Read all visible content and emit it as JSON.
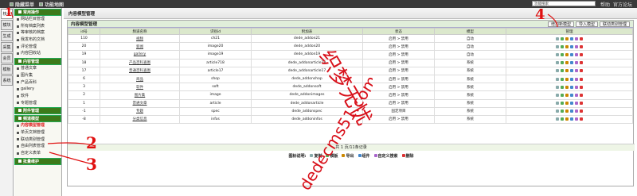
{
  "topbar": {
    "hide_menu": "隐藏菜单",
    "func_map": "功能地图",
    "right": [
      "帮助",
      "官方论坛"
    ]
  },
  "search": "功能搜索",
  "vtabs": [
    "核心",
    "模块",
    "生成",
    "采集",
    "会员",
    "模板",
    "系统"
  ],
  "sidebar": {
    "groups": [
      {
        "title": "常用操作",
        "items": [
          "网站栏目管理",
          "所有档案列表",
          "等审核的档案",
          "我发布的文档",
          "评论管理",
          "内容回收站"
        ]
      },
      {
        "title": "内容管理",
        "items": [
          "普通文章",
          "图片集",
          "产品百科",
          "gallery",
          "软件",
          "专题管理"
        ]
      },
      {
        "title": "附件管理",
        "items": []
      },
      {
        "title": "频道模型",
        "items": [
          "内容模型管理",
          "单页文档管理",
          "联动类别管理",
          "自由列表管理",
          "自定义表单"
        ]
      },
      {
        "title": "批量维护",
        "items": []
      }
    ]
  },
  "main": {
    "header": "内容模型管理",
    "bar_title": "内容模型管理",
    "buttons": [
      "增加新模型",
      "导入模型",
      "联动类别管理"
    ]
  },
  "table": {
    "headers": [
      "id号",
      "频道名称",
      "识别id",
      "附加表",
      "状态",
      "模型",
      "管理"
    ],
    "rows": [
      [
        "110",
        "视频",
        "ch21",
        "dede_addon21",
        "启用 > 禁用",
        "自动"
      ],
      [
        "20",
        "新闻",
        "image20",
        "dede_addon20",
        "启用 > 禁用",
        "自动"
      ],
      [
        "19",
        "gallery",
        "image19",
        "dede_addon19",
        "启用 > 禁用",
        "自动"
      ],
      [
        "18",
        "产品百科查图",
        "article718",
        "dede_addonarticle18",
        "启用 > 禁用",
        "系统"
      ],
      [
        "17",
        "普通百科查图",
        "article17",
        "dede_addonarticle17",
        "启用 > 禁用",
        "系统"
      ],
      [
        "6",
        "商品",
        "shop",
        "dede_addonshop",
        "启用 > 禁用",
        "系统"
      ],
      [
        "3",
        "软件",
        "soft",
        "dede_addonsoft",
        "启用 > 禁用",
        "系统"
      ],
      [
        "2",
        "图片集",
        "image",
        "dede_addonimages",
        "启用 > 禁用",
        "系统"
      ],
      [
        "1",
        "普通文章",
        "article",
        "dede_addonarticle",
        "启用 > 禁用",
        "系统"
      ],
      [
        "-1",
        "专题",
        "spec",
        "dede_addonspec",
        "固定项目",
        "系统"
      ],
      [
        "-8",
        "分类信息",
        "infos",
        "dede_addoninfos",
        "启用 > 禁用",
        "系统"
      ]
    ]
  },
  "footer": "共 1 页/11条记录",
  "legend": {
    "label": "图标说明:",
    "items": [
      "复制",
      "模板",
      "导出",
      "组件",
      "自定义搜索",
      "删除"
    ]
  },
  "watermark": [
    "织梦无忧",
    "dedecms51.com"
  ],
  "annotations": [
    "1",
    "2",
    "3",
    "4"
  ],
  "colors": {
    "green": "#3d7a1a",
    "red": "#e01010"
  }
}
